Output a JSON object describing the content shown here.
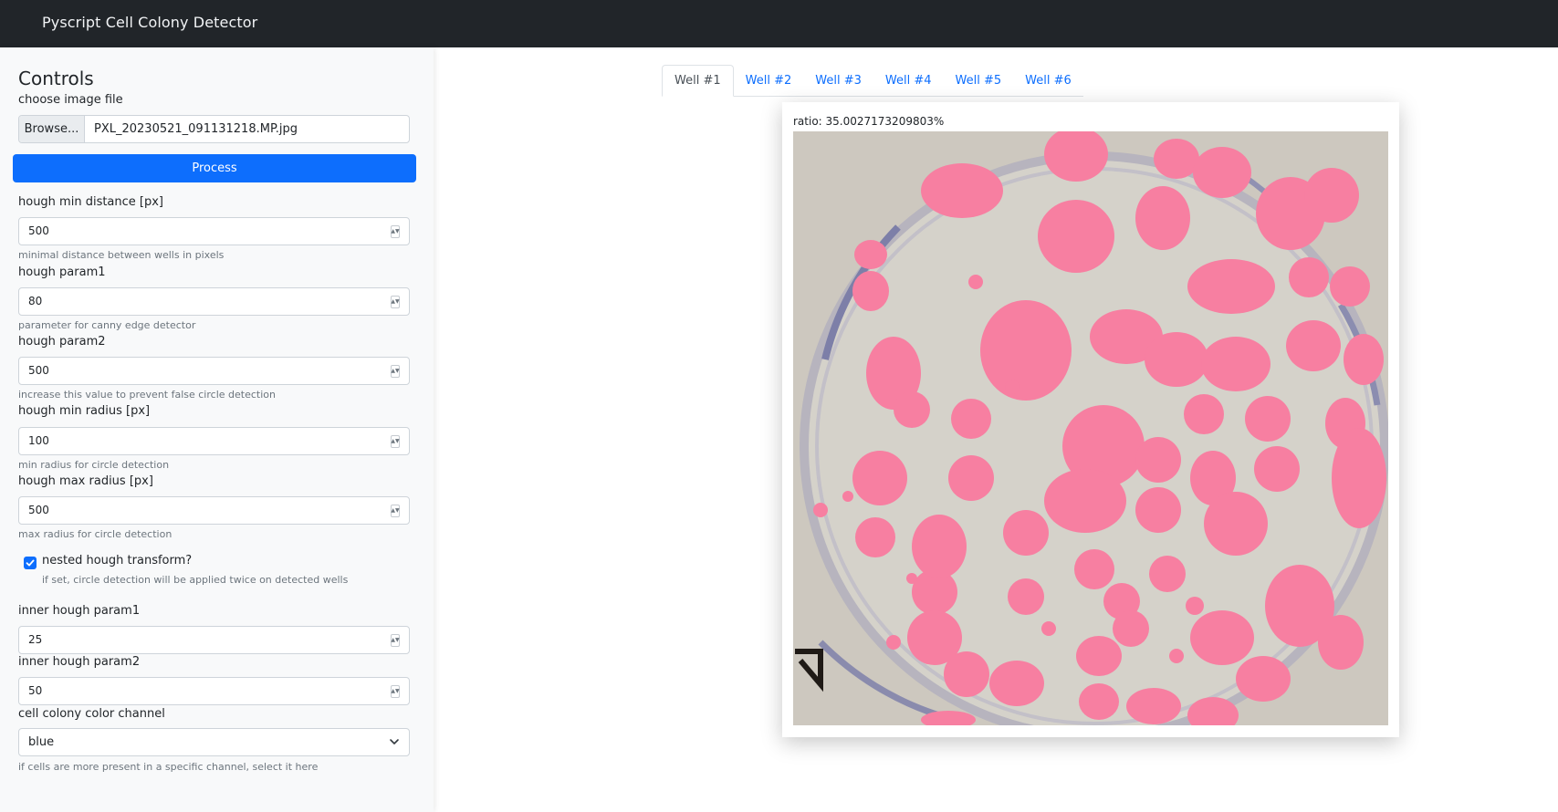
{
  "navbar": {
    "title": "Pyscript Cell Colony Detector"
  },
  "controls": {
    "heading": "Controls",
    "file": {
      "label": "choose image file",
      "button": "Browse...",
      "filename": "PXL_20230521_091131218.MP.jpg"
    },
    "process_label": "Process",
    "fields": [
      {
        "label": "hough min distance [px]",
        "value": "500",
        "help": "minimal distance between wells in pixels"
      },
      {
        "label": "hough param1",
        "value": "80",
        "help": "parameter for canny edge detector"
      },
      {
        "label": "hough param2",
        "value": "500",
        "help": "increase this value to prevent false circle detection"
      },
      {
        "label": "hough min radius [px]",
        "value": "100",
        "help": "min radius for circle detection"
      },
      {
        "label": "hough max radius [px]",
        "value": "500",
        "help": "max radius for circle detection"
      }
    ],
    "nested": {
      "label": "nested hough transform?",
      "help": "if set, circle detection will be applied twice on detected wells",
      "checked": true
    },
    "inner_fields": [
      {
        "label": "inner hough param1",
        "value": "25"
      },
      {
        "label": "inner hough param2",
        "value": "50"
      }
    ],
    "color_channel": {
      "label": "cell colony color channel",
      "value": "blue",
      "help": "if cells are more present in a specific channel, select it here"
    }
  },
  "tabs": [
    "Well #1",
    "Well #2",
    "Well #3",
    "Well #4",
    "Well #5",
    "Well #6"
  ],
  "result": {
    "ratio": "ratio: 35.0027173209803%"
  },
  "colors": {
    "navbar": "#212529",
    "accent": "#0d6efd",
    "sidebar": "#f8f9fa",
    "colony": "#f77fa1",
    "dish": "#cdc8bf"
  }
}
